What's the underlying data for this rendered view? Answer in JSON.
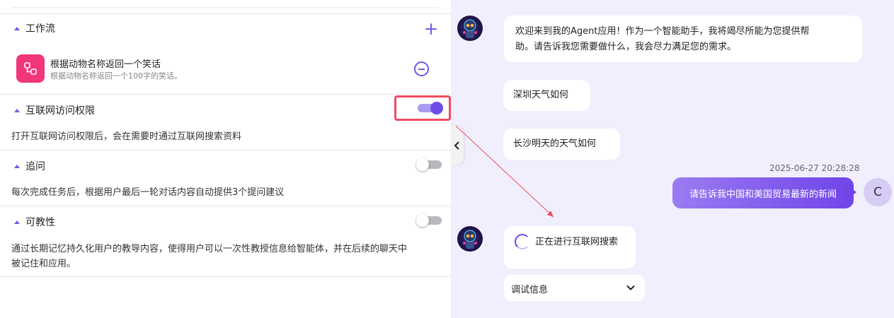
{
  "left_panel": {
    "workflow": {
      "title": "工作流",
      "item_title": "根据动物名称返回一个笑话",
      "item_desc": "根据动物名称返回一个100字的笑话。"
    },
    "internet_access": {
      "title": "互联网访问权限",
      "enabled": true,
      "description": "打开互联网访问权限后，会在需要时通过互联网搜索资料"
    },
    "follow_up": {
      "title": "追问",
      "enabled": false,
      "description": "每次完成任务后，根据用户最后一轮对话内容自动提供3个提问建议"
    },
    "teachability": {
      "title": "可教性",
      "enabled": false,
      "description_line1": "通过长期记忆持久化用户的教导内容，使得用户可以一次性教授信息给智能体，并在后续的聊天中",
      "description_line2": "被记住和应用。"
    }
  },
  "chat": {
    "welcome_line1": "欢迎来到我的Agent应用！作为一个智能助手，我将竭尽所能为您提供帮",
    "welcome_line2": "助。请告诉我您需要做什么，我会尽力满足您的需求。",
    "suggestion_1": "深圳天气如何",
    "suggestion_2": "长沙明天的天气如何",
    "timestamp": "2025-06-27 20:28:28",
    "user_message": "请告诉我中国和美国贸易最新的新闻",
    "user_avatar_letter": "C",
    "status": "正在进行互联网搜索",
    "debug_label": "调试信息"
  },
  "colors": {
    "accent": "#6d4de6",
    "workflow_icon_bg": "#f2367a",
    "highlight_border": "#ef4c5f",
    "chat_bg": "#f1effd"
  },
  "icons": {
    "add": "plus-icon",
    "remove": "minus-circle-icon",
    "collapse": "chevron-left-icon",
    "expand": "chevron-down-icon",
    "workflow": "workflow-icon",
    "loading": "spinner-icon"
  }
}
